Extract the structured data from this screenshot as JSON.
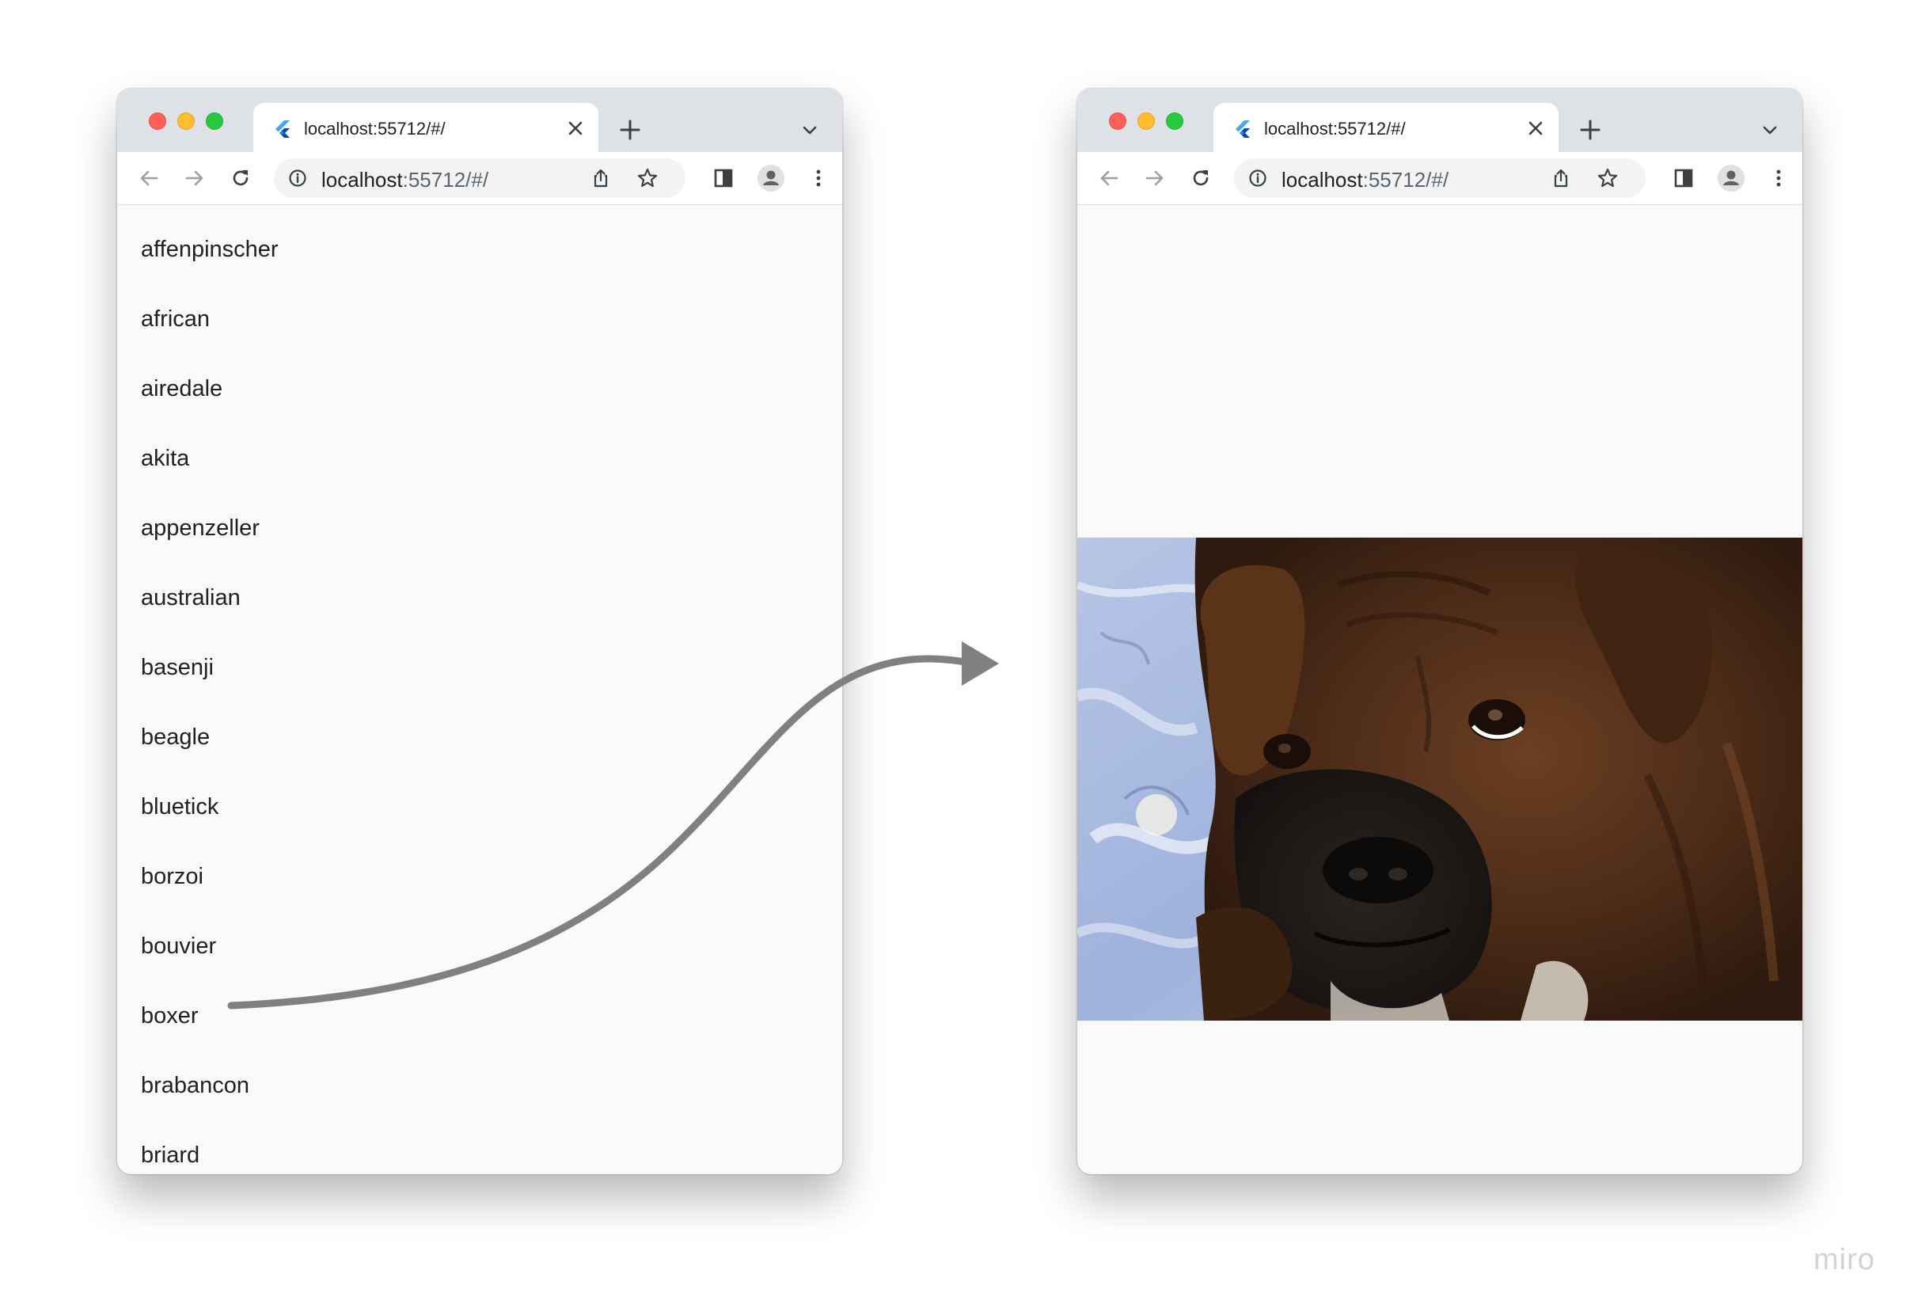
{
  "browser": {
    "tab_title": "localhost:55712/#/",
    "url_host": "localhost",
    "url_rest": ":55712/#/"
  },
  "list_page": {
    "breeds": [
      "affenpinscher",
      "african",
      "airedale",
      "akita",
      "appenzeller",
      "australian",
      "basenji",
      "beagle",
      "bluetick",
      "borzoi",
      "bouvier",
      "boxer",
      "brabancon",
      "briard"
    ],
    "selected": "boxer"
  },
  "detail_page": {
    "image_subject": "boxer dog lying on a blue floral blanket"
  },
  "icons": {
    "favicon": "flutter-icon",
    "back": "arrow-left-icon",
    "forward": "arrow-right-icon",
    "reload": "reload-icon",
    "info": "info-icon",
    "share": "share-icon",
    "bookmark": "star-icon",
    "side_panel": "side-panel-icon",
    "profile": "profile-icon",
    "menu": "more-vert-icon"
  },
  "colors": {
    "close": "#ff5f57",
    "minimize": "#febc2e",
    "maximize": "#28c840",
    "titlebar": "#dee1e6",
    "arrow": "#808080",
    "page_bg": "#fafafa"
  },
  "watermark": "miro"
}
